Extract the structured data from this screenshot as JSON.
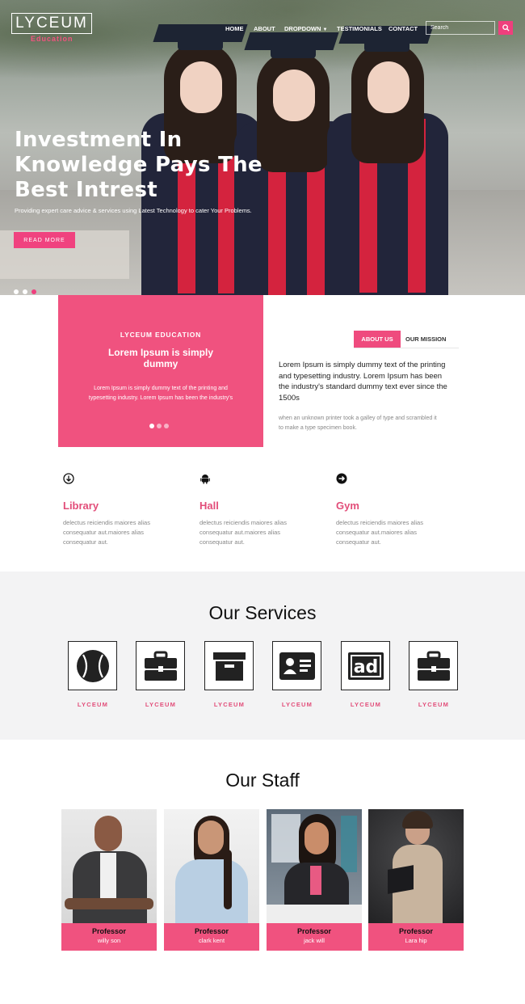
{
  "nav": {
    "logo": "LYCEUM",
    "logo_sub": "Education",
    "items": [
      "HOME",
      "ABOUT",
      "DROPDOWN",
      "TESTIMONIALS",
      "CONTACT"
    ],
    "search_placeholder": "Search"
  },
  "hero": {
    "title": "Investment In Knowledge Pays The Best Intrest",
    "description": "Providing expert care advice & services using Latest Technology to cater Your Problems.",
    "button": "READ MORE"
  },
  "about": {
    "eyebrow": "LYCEUM EDUCATION",
    "title": "Lorem Ipsum is simply dummy",
    "text": "Lorem Ipsum is simply dummy text of the printing and typesetting industry. Lorem Ipsum has been the industry's",
    "tab_about": "ABOUT US",
    "tab_mission": "OUR MISSION",
    "lead": "Lorem Ipsum is simply dummy text of the printing and typesetting industry. Lorem Ipsum has been the industry's standard dummy text ever since the 1500s",
    "sub": "when an unknown printer took a galley of type and scrambled it to make a type specimen book."
  },
  "features": [
    {
      "icon": "circle-arrow-down-icon",
      "title": "Library",
      "text": "delectus reiciendis maiores alias consequatur aut.maiores alias consequatur aut."
    },
    {
      "icon": "android-icon",
      "title": "Hall",
      "text": "delectus reiciendis maiores alias consequatur aut.maiores alias consequatur aut."
    },
    {
      "icon": "circle-arrow-right-icon",
      "title": "Gym",
      "text": "delectus reiciendis maiores alias consequatur aut.maiores alias consequatur aut."
    }
  ],
  "services": {
    "title": "Our Services",
    "items": [
      {
        "icon": "baseball-icon",
        "label": "LYCEUM"
      },
      {
        "icon": "briefcase-icon",
        "label": "LYCEUM"
      },
      {
        "icon": "archive-box-icon",
        "label": "LYCEUM"
      },
      {
        "icon": "id-card-icon",
        "label": "LYCEUM"
      },
      {
        "icon": "ad-icon",
        "label": "LYCEUM"
      },
      {
        "icon": "briefcase-icon",
        "label": "LYCEUM"
      }
    ]
  },
  "staff": {
    "title": "Our Staff",
    "members": [
      {
        "role": "Professor",
        "name": "willy son"
      },
      {
        "role": "Professor",
        "name": "clark kent"
      },
      {
        "role": "Professor",
        "name": "jack will"
      },
      {
        "role": "Professor",
        "name": "Lara hip"
      }
    ]
  },
  "colors": {
    "accent": "#f0527f",
    "text": "#111111",
    "muted": "#888888",
    "services_bg": "#f3f3f4"
  }
}
